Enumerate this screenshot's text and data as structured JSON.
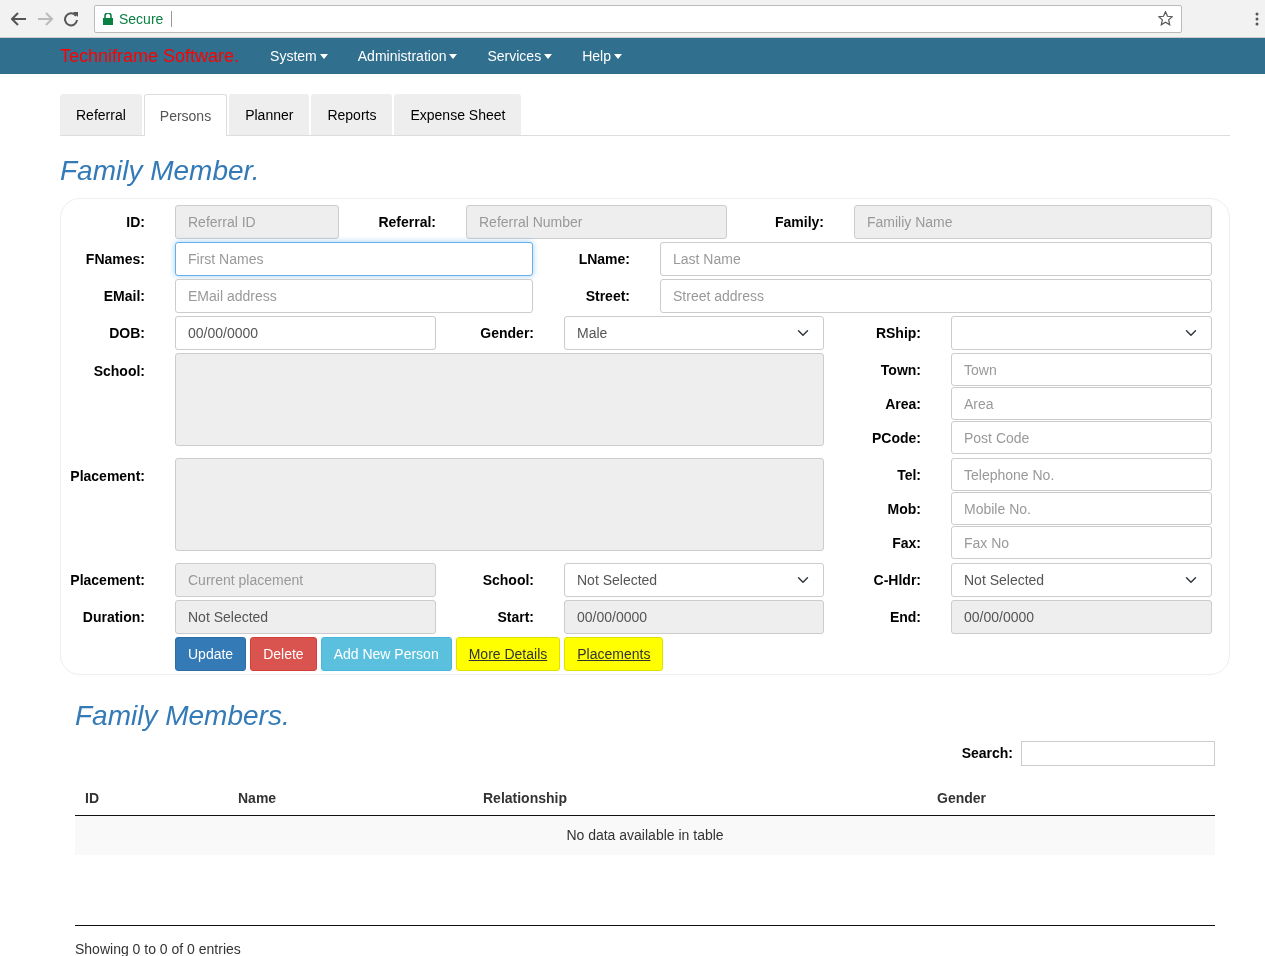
{
  "browser": {
    "secure_label": "Secure"
  },
  "navbar": {
    "brand": "Techniframe Software.",
    "menus": [
      "System",
      "Administration",
      "Services",
      "Help"
    ]
  },
  "tabs": [
    {
      "label": "Referral",
      "selected": false
    },
    {
      "label": "Persons",
      "selected": true
    },
    {
      "label": "Planner",
      "selected": false
    },
    {
      "label": "Reports",
      "selected": false
    },
    {
      "label": "Expense Sheet",
      "selected": false
    }
  ],
  "form": {
    "title": "Family Member.",
    "top_rows": [
      [
        {
          "label": "ID:",
          "kind": "input",
          "placeholder": "Referral ID",
          "disabled": true
        },
        {
          "label": "Referral:",
          "kind": "input",
          "placeholder": "Referral Number",
          "disabled": true
        },
        {
          "label": "Family:",
          "kind": "input",
          "placeholder": "Familiy Name",
          "disabled": true
        }
      ],
      [
        {
          "label": "FNames:",
          "kind": "input",
          "placeholder": "First Names",
          "disabled": false,
          "focused": true
        },
        {
          "label": "LName:",
          "kind": "input",
          "placeholder": "Last Name",
          "disabled": false
        }
      ],
      [
        {
          "label": "EMail:",
          "kind": "input",
          "placeholder": "EMail address",
          "disabled": false
        },
        {
          "label": "Street:",
          "kind": "input",
          "placeholder": "Street address",
          "disabled": false
        }
      ],
      [
        {
          "label": "DOB:",
          "kind": "input",
          "value": "00/00/0000",
          "disabled": false
        },
        {
          "label": "Gender:",
          "kind": "select",
          "value": "Male",
          "disabled": false
        },
        {
          "label": "RShip:",
          "kind": "select",
          "disabled": false
        }
      ]
    ],
    "middle": [
      {
        "label": "School:",
        "side": [
          {
            "label": "Town:",
            "placeholder": "Town"
          },
          {
            "label": "Area:",
            "placeholder": "Area"
          },
          {
            "label": "PCode:",
            "placeholder": "Post Code"
          }
        ]
      },
      {
        "label": "Placement:",
        "side": [
          {
            "label": "Tel:",
            "placeholder": "Telephone No."
          },
          {
            "label": "Mob:",
            "placeholder": "Mobile No."
          },
          {
            "label": "Fax:",
            "placeholder": "Fax No"
          }
        ]
      }
    ],
    "bottom_rows": [
      [
        {
          "label": "Placement:",
          "kind": "input",
          "placeholder": "Current placement",
          "disabled": true
        },
        {
          "label": "School:",
          "kind": "select",
          "value": "Not Selected",
          "disabled": false
        },
        {
          "label": "C-Hldr:",
          "kind": "select",
          "value": "Not Selected",
          "disabled": false
        }
      ],
      [
        {
          "label": "Duration:",
          "kind": "input",
          "value": "Not Selected",
          "disabled": true
        },
        {
          "label": "Start:",
          "kind": "input",
          "value": "00/00/0000",
          "disabled": true
        },
        {
          "label": "End:",
          "kind": "input",
          "value": "00/00/0000",
          "disabled": true
        }
      ]
    ],
    "buttons": [
      {
        "label": "Update",
        "kind": "primary"
      },
      {
        "label": "Delete",
        "kind": "danger"
      },
      {
        "label": "Add New Person",
        "kind": "info"
      },
      {
        "label": "More Details",
        "kind": "link"
      },
      {
        "label": "Placements",
        "kind": "link"
      }
    ]
  },
  "members": {
    "title": "Family Members.",
    "search_label": "Search:",
    "columns": [
      "ID",
      "Name",
      "Relationship",
      "Gender"
    ],
    "empty_message": "No data available in table",
    "info": "Showing 0 to 0 of 0 entries"
  }
}
